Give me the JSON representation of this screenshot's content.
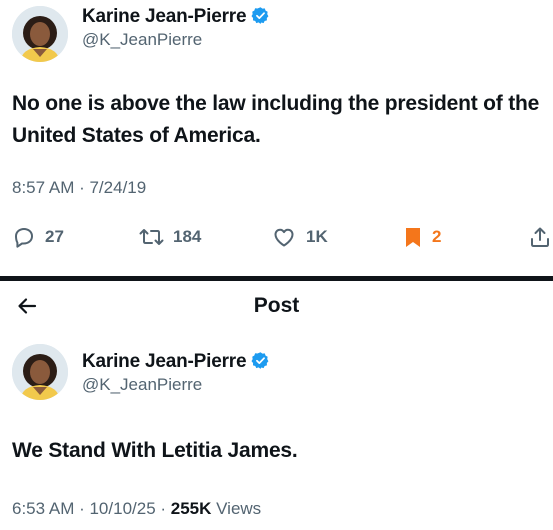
{
  "tweet1": {
    "author": {
      "display_name": "Karine Jean-Pierre",
      "handle": "@K_JeanPierre",
      "verified_icon": "verified-badge-icon"
    },
    "text": "No one is above the law including the president of the United States of America.",
    "timestamp": "8:57 AM · 7/24/19",
    "actions": {
      "reply_count": "27",
      "retweet_count": "184",
      "like_count": "1K",
      "bookmark_count": "2"
    }
  },
  "tweet2": {
    "header": {
      "title": "Post"
    },
    "author": {
      "display_name": "Karine Jean-Pierre",
      "handle": "@K_JeanPierre",
      "verified_icon": "verified-badge-icon"
    },
    "text": "We Stand With Letitia James.",
    "meta": {
      "time": "6:53 AM · 10/10/25 · ",
      "views_count": "255K",
      "views_label": "Views"
    }
  },
  "colors": {
    "text_primary": "#0f1419",
    "text_secondary": "#536471",
    "verified_blue": "#1d9bf0",
    "bookmark_orange": "#f4761b",
    "divider": "#0f1419"
  },
  "icons": [
    "arrow-left-icon",
    "reply-icon",
    "retweet-icon",
    "like-icon",
    "bookmark-icon",
    "share-icon",
    "verified-badge-icon"
  ]
}
